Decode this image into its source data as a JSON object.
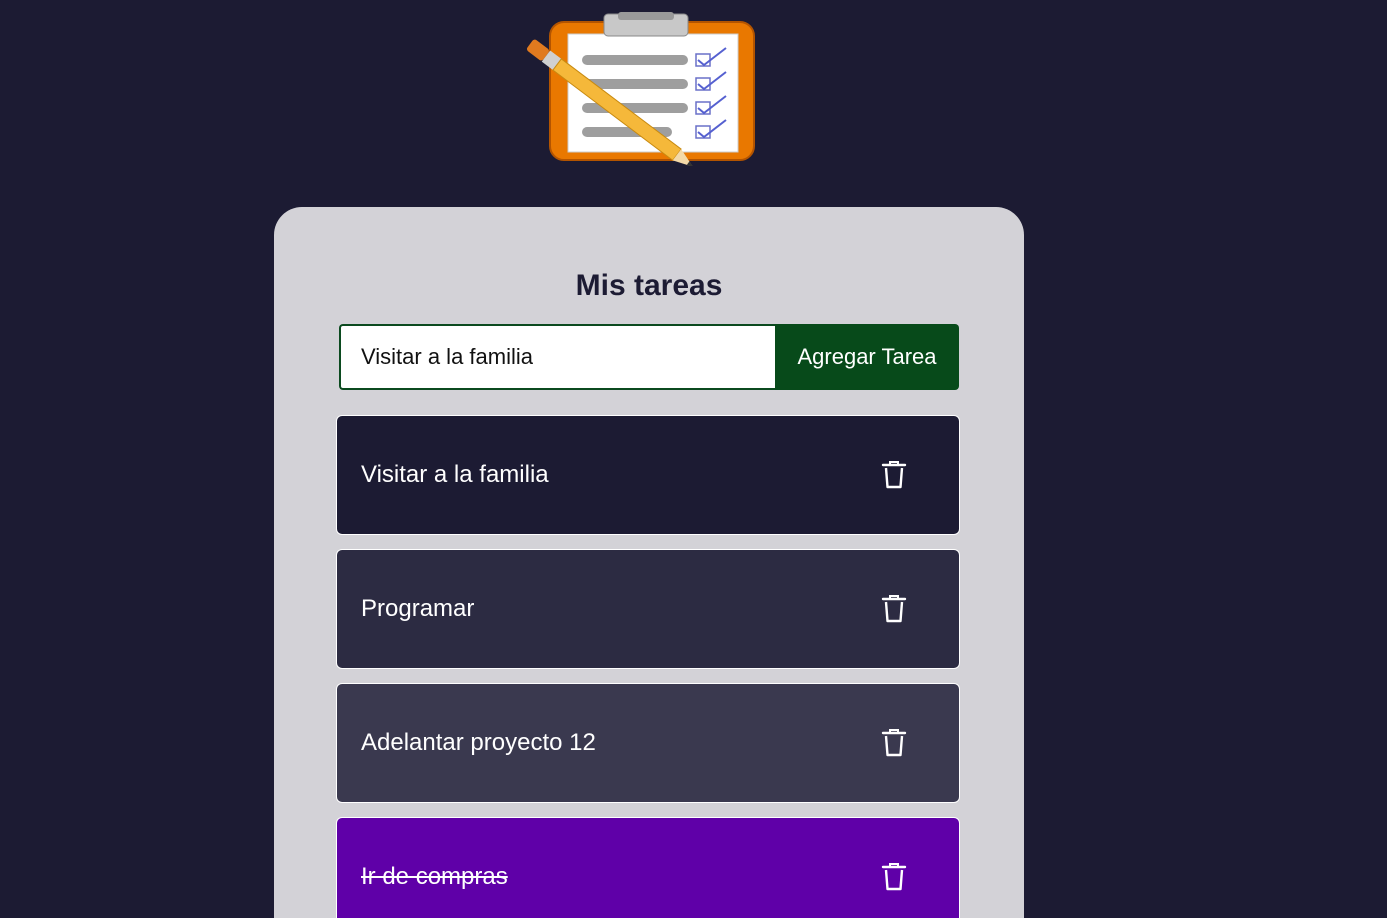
{
  "app": {
    "logo_icon": "clipboard-checklist-icon"
  },
  "header": {
    "title": "Mis tareas"
  },
  "form": {
    "input_value": "Visitar a la familia",
    "add_label": "Agregar Tarea"
  },
  "tasks": [
    {
      "text": "Visitar a la familia",
      "color": "#1c1b33",
      "completed": false
    },
    {
      "text": "Programar",
      "color": "#2c2b42",
      "completed": false
    },
    {
      "text": "Adelantar proyecto 12",
      "color": "#3a394f",
      "completed": false
    },
    {
      "text": "Ir de compras",
      "color": "#5f00a8",
      "completed": true
    }
  ],
  "icons": {
    "delete": "trash-icon"
  }
}
